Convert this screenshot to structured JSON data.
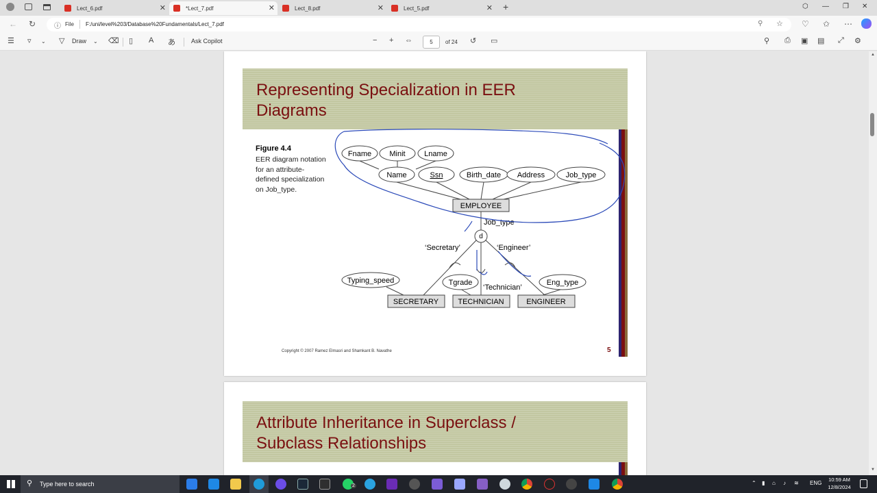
{
  "tabs": [
    {
      "label": "Lect_6.pdf",
      "active": false
    },
    {
      "label": "*Lect_7.pdf",
      "active": true
    },
    {
      "label": "Lect_8.pdf",
      "active": false
    },
    {
      "label": "Lect_5.pdf",
      "active": false
    }
  ],
  "address": {
    "scheme_label": "File",
    "url": "F:/uni/level%203/Database%20Fundamentals/Lect_7.pdf"
  },
  "toolbar": {
    "draw_label": "Draw",
    "copilot_label": "Ask Copilot",
    "current_page": "5",
    "page_total": "of 24"
  },
  "page1": {
    "title_line1": "Representing Specialization in EER",
    "title_line2": "Diagrams",
    "figure_label": "Figure 4.4",
    "caption_lines": [
      "EER diagram notation",
      "for an attribute-",
      "defined specialization",
      "on Job_type."
    ],
    "diagram": {
      "attributes_top": [
        "Fname",
        "Minit",
        "Lname"
      ],
      "attributes_mid": [
        "Name",
        "Ssn",
        "Birth_date",
        "Address",
        "Job_type"
      ],
      "entity": "EMPLOYEE",
      "defining_attribute": "Job_type",
      "disjoint_symbol": "d",
      "branch_labels": [
        "‘Secretary’",
        "‘Technician’",
        "‘Engineer’"
      ],
      "sub_attributes": [
        "Typing_speed",
        "Tgrade",
        "Eng_type"
      ],
      "subclasses": [
        "SECRETARY",
        "TECHNICIAN",
        "ENGINEER"
      ]
    },
    "copyright": "Copyright © 2007 Ramez Elmasri and Shamkant B. Navathe",
    "page_number": "5"
  },
  "page2": {
    "title_line1": "Attribute Inheritance in Superclass /",
    "title_line2": "Subclass Relationships"
  },
  "taskbar": {
    "search_placeholder": "Type here to search",
    "language": "ENG",
    "time": "10:59 AM",
    "date": "12/8/2024",
    "whatsapp_badge": "2"
  }
}
